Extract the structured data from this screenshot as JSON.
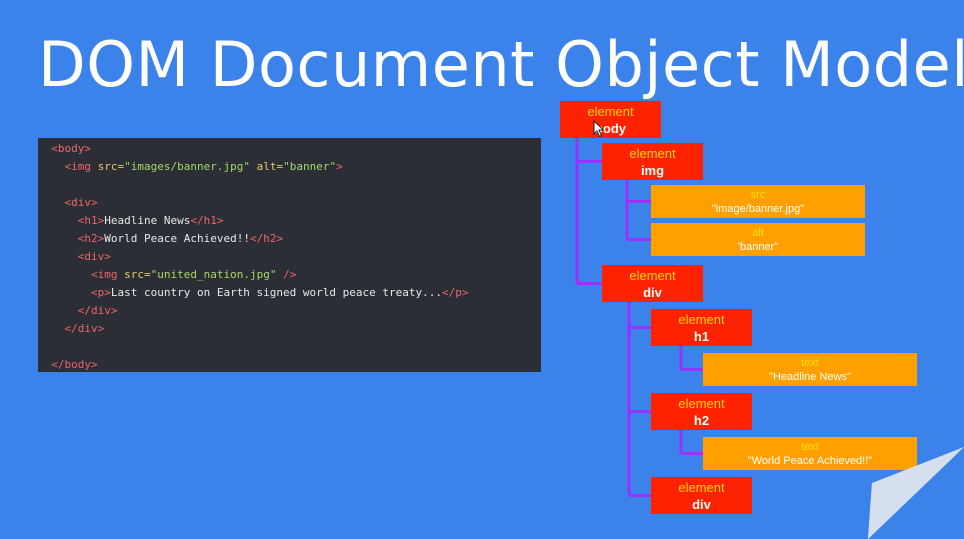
{
  "slide": {
    "title": "DOM Document Object Model"
  },
  "code_lines": [
    [
      {
        "t": "  ",
        "c": "txt"
      },
      {
        "t": "<body>",
        "c": "tag"
      }
    ],
    [
      {
        "t": "    ",
        "c": "txt"
      },
      {
        "t": "<img ",
        "c": "tag"
      },
      {
        "t": "src=",
        "c": "attr"
      },
      {
        "t": "\"images/banner.jpg\"",
        "c": "str"
      },
      {
        "t": " ",
        "c": "txt"
      },
      {
        "t": "alt=",
        "c": "attr"
      },
      {
        "t": "\"banner\"",
        "c": "str"
      },
      {
        "t": ">",
        "c": "tag"
      }
    ],
    [
      {
        "t": "",
        "c": "txt"
      }
    ],
    [
      {
        "t": "    ",
        "c": "txt"
      },
      {
        "t": "<div>",
        "c": "tag"
      }
    ],
    [
      {
        "t": "      ",
        "c": "txt"
      },
      {
        "t": "<h1>",
        "c": "tag"
      },
      {
        "t": "Headline News",
        "c": "txt"
      },
      {
        "t": "</h1>",
        "c": "tag"
      }
    ],
    [
      {
        "t": "      ",
        "c": "txt"
      },
      {
        "t": "<h2>",
        "c": "tag"
      },
      {
        "t": "World Peace Achieved!!",
        "c": "txt"
      },
      {
        "t": "</h2>",
        "c": "tag"
      }
    ],
    [
      {
        "t": "      ",
        "c": "txt"
      },
      {
        "t": "<div>",
        "c": "tag"
      }
    ],
    [
      {
        "t": "        ",
        "c": "txt"
      },
      {
        "t": "<img ",
        "c": "tag"
      },
      {
        "t": "src=",
        "c": "attr"
      },
      {
        "t": "\"united_nation.jpg\"",
        "c": "str"
      },
      {
        "t": " />",
        "c": "tag"
      }
    ],
    [
      {
        "t": "        ",
        "c": "txt"
      },
      {
        "t": "<p>",
        "c": "tag"
      },
      {
        "t": "Last country on Earth signed world peace treaty...",
        "c": "txt"
      },
      {
        "t": "</p>",
        "c": "tag"
      }
    ],
    [
      {
        "t": "      ",
        "c": "txt"
      },
      {
        "t": "</div>",
        "c": "tag"
      }
    ],
    [
      {
        "t": "    ",
        "c": "txt"
      },
      {
        "t": "</div>",
        "c": "tag"
      }
    ],
    [
      {
        "t": "",
        "c": "txt"
      }
    ],
    [
      {
        "t": "  ",
        "c": "txt"
      },
      {
        "t": "</body>",
        "c": "tag"
      }
    ]
  ],
  "tree": {
    "nodes": [
      {
        "id": "body",
        "kind": "el",
        "key": "element",
        "value": "body"
      },
      {
        "id": "img",
        "kind": "el",
        "key": "element",
        "value": "img"
      },
      {
        "id": "src",
        "kind": "leaf",
        "key": "src",
        "value": "\"image/banner.jpg\""
      },
      {
        "id": "alt",
        "kind": "leaf",
        "key": "alt",
        "value": "'banner\""
      },
      {
        "id": "div",
        "kind": "el",
        "key": "element",
        "value": "div"
      },
      {
        "id": "h1",
        "kind": "el",
        "key": "element",
        "value": "h1"
      },
      {
        "id": "h1text",
        "kind": "leaf",
        "key": "text",
        "value": "\"Headline News\""
      },
      {
        "id": "h2",
        "kind": "el",
        "key": "element",
        "value": "h2"
      },
      {
        "id": "h2text",
        "kind": "leaf",
        "key": "text",
        "value": "\"World Peace Achieved!!\""
      },
      {
        "id": "div2",
        "kind": "el",
        "key": "element",
        "value": "div"
      }
    ]
  },
  "colors": {
    "background": "#3b82ea",
    "element": "#ff2200",
    "leaf": "#ffa000",
    "connector": "#9b30ff"
  }
}
